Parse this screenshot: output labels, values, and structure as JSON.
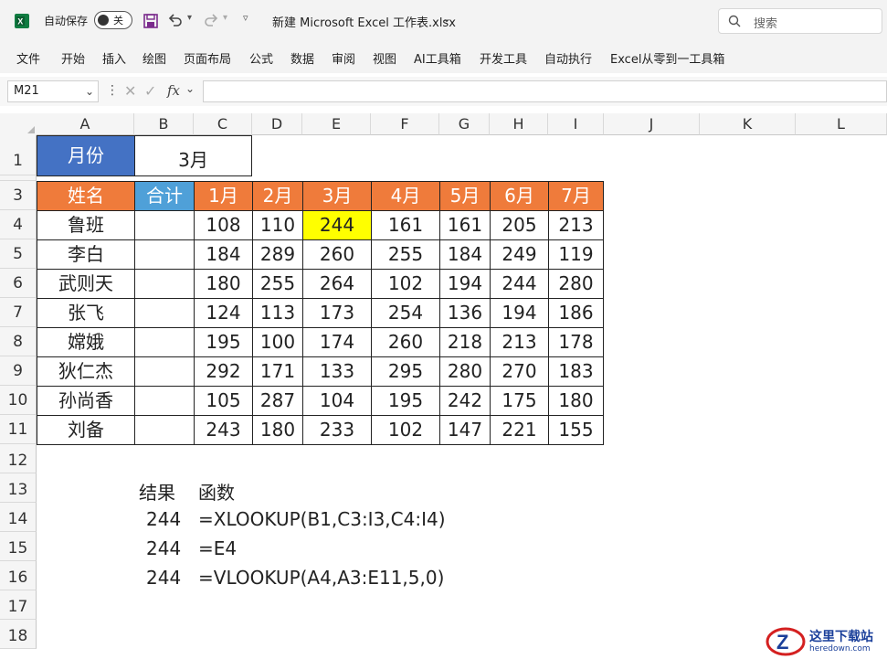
{
  "app": {
    "autosave_label": "自动保存",
    "autosave_state": "关",
    "filename": "新建 Microsoft Excel 工作表.xlsx",
    "search_placeholder": "搜索"
  },
  "menu": [
    "文件",
    "开始",
    "插入",
    "绘图",
    "页面布局",
    "公式",
    "数据",
    "审阅",
    "视图",
    "AI工具箱",
    "开发工具",
    "自动执行",
    "Excel从零到一工具箱"
  ],
  "formula_bar": {
    "name_box": "M21",
    "fx": "fx",
    "formula": ""
  },
  "columns": [
    "A",
    "B",
    "C",
    "D",
    "E",
    "F",
    "G",
    "H",
    "I",
    "J",
    "K",
    "L"
  ],
  "rows": [
    "1",
    "2",
    "3",
    "4",
    "5",
    "6",
    "7",
    "8",
    "9",
    "10",
    "11",
    "12",
    "13",
    "14",
    "15",
    "16",
    "17",
    "18"
  ],
  "lookup": {
    "month_label": "月份",
    "month_value": "3月"
  },
  "table": {
    "headers": [
      "姓名",
      "合计",
      "1月",
      "2月",
      "3月",
      "4月",
      "5月",
      "6月",
      "7月"
    ],
    "rows": [
      {
        "name": "鲁班",
        "values": [
          "108",
          "110",
          "244",
          "161",
          "161",
          "205",
          "213"
        ]
      },
      {
        "name": "李白",
        "values": [
          "184",
          "289",
          "260",
          "255",
          "184",
          "249",
          "119"
        ]
      },
      {
        "name": "武则天",
        "values": [
          "180",
          "255",
          "264",
          "102",
          "194",
          "244",
          "280"
        ]
      },
      {
        "name": "张飞",
        "values": [
          "124",
          "113",
          "173",
          "254",
          "136",
          "194",
          "186"
        ]
      },
      {
        "name": "嫦娥",
        "values": [
          "195",
          "100",
          "174",
          "260",
          "218",
          "213",
          "178"
        ]
      },
      {
        "name": "狄仁杰",
        "values": [
          "292",
          "171",
          "133",
          "295",
          "280",
          "270",
          "183"
        ]
      },
      {
        "name": "孙尚香",
        "values": [
          "105",
          "287",
          "104",
          "195",
          "242",
          "175",
          "180"
        ]
      },
      {
        "name": "刘备",
        "values": [
          "243",
          "180",
          "233",
          "102",
          "147",
          "221",
          "155"
        ]
      }
    ]
  },
  "results": {
    "header_result": "结果",
    "header_function": "函数",
    "items": [
      {
        "value": "244",
        "formula": "=XLOOKUP(B1,C3:I3,C4:I4)"
      },
      {
        "value": "244",
        "formula": "=E4"
      },
      {
        "value": "244",
        "formula": "=VLOOKUP(A4,A3:E11,5,0)"
      }
    ]
  },
  "watermark": {
    "text": "这里下载站",
    "sub": "heredown.com"
  }
}
